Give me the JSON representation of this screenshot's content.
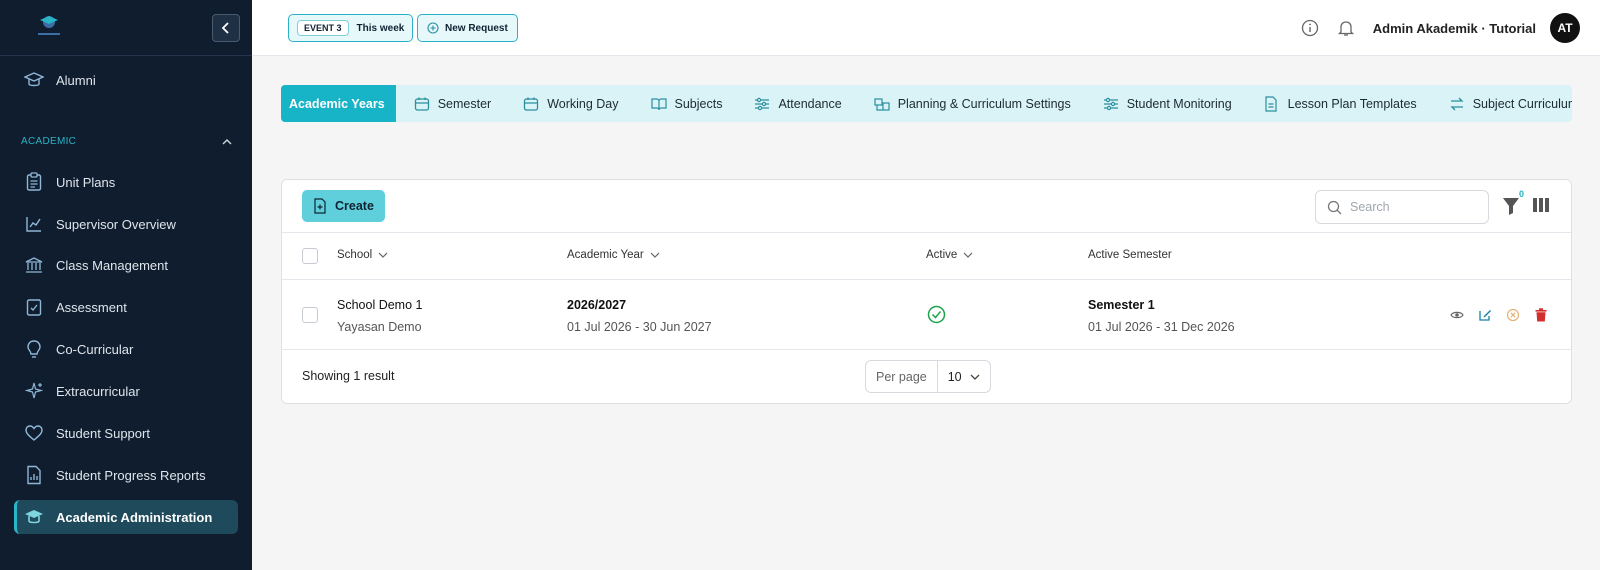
{
  "sidebar": {
    "section_label": "ACADEMIC",
    "items": [
      {
        "label": "Alumni",
        "icon": "graduation-cap-icon"
      },
      {
        "label": "Unit Plans",
        "icon": "clipboard-icon"
      },
      {
        "label": "Supervisor Overview",
        "icon": "chart-line-icon"
      },
      {
        "label": "Class Management",
        "icon": "building-columns-icon"
      },
      {
        "label": "Assessment",
        "icon": "clipboard-check-icon"
      },
      {
        "label": "Co-Curricular",
        "icon": "lightbulb-icon"
      },
      {
        "label": "Extracurricular",
        "icon": "sparkles-icon"
      },
      {
        "label": "Student Support",
        "icon": "heart-icon"
      },
      {
        "label": "Student Progress Reports",
        "icon": "file-chart-icon"
      },
      {
        "label": "Academic Administration",
        "icon": "graduation-cap-icon"
      }
    ]
  },
  "topbar": {
    "event_tag": "EVENT 3",
    "event_label": "This week",
    "new_request_label": "New Request",
    "user_name": "Admin Akademik · Tutorial",
    "avatar_initials": "AT"
  },
  "tabs": [
    {
      "label": "Academic Years"
    },
    {
      "label": "Semester"
    },
    {
      "label": "Working Day"
    },
    {
      "label": "Subjects"
    },
    {
      "label": "Attendance"
    },
    {
      "label": "Planning & Curriculum Settings"
    },
    {
      "label": "Student Monitoring"
    },
    {
      "label": "Lesson Plan Templates"
    },
    {
      "label": "Subject Curriculum Mappi"
    }
  ],
  "toolbar": {
    "create_label": "Create",
    "search_placeholder": "Search",
    "filter_count": "0"
  },
  "table": {
    "columns": [
      "School",
      "Academic Year",
      "Active",
      "Active Semester"
    ],
    "rows": [
      {
        "school": "School Demo 1",
        "school_sub": "Yayasan Demo",
        "year": "2026/2027",
        "year_range": "01 Jul 2026 - 30 Jun 2027",
        "semester": "Semester 1",
        "semester_range": "01 Jul 2026 - 31 Dec 2026"
      }
    ]
  },
  "footer": {
    "result_text": "Showing 1 result",
    "per_page_label": "Per page",
    "per_page_value": "10"
  },
  "colors": {
    "sidebar_bg": "#0f1d2e",
    "accent": "#17b3c7",
    "tab_bg": "#d9f3f6",
    "active_check": "#1aa34a",
    "delete": "#d32f2f"
  }
}
